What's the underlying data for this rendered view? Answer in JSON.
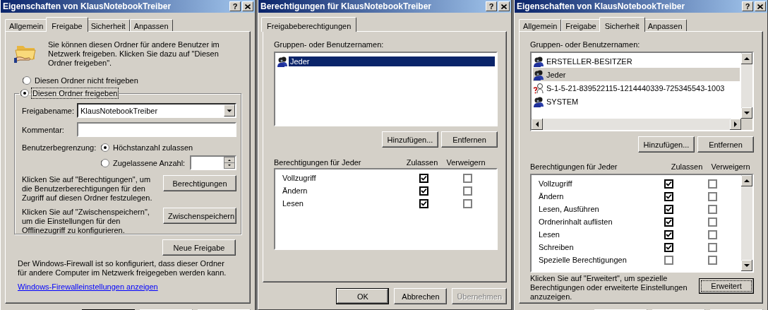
{
  "dialogs": [
    {
      "kind": "sharing",
      "title": "Eigenschaften von KlausNotebookTreiber",
      "help_button": "?",
      "tabs": [
        {
          "label": "Allgemein",
          "selected": false
        },
        {
          "label": "Freigabe",
          "selected": true
        },
        {
          "label": "Sicherheit",
          "selected": false
        },
        {
          "label": "Anpassen",
          "selected": false
        }
      ],
      "intro": "Sie können diesen Ordner für andere Benutzer im Netzwerk freigeben. Klicken Sie dazu auf \"Diesen Ordner freigeben\".",
      "share_options": [
        {
          "label": "Diesen Ordner nicht freigeben",
          "selected": false
        },
        {
          "label": "Diesen Ordner freigeben",
          "selected": true
        }
      ],
      "share_name": {
        "label": "Freigabename:",
        "value": "KlausNotebookTreiber"
      },
      "comment": {
        "label": "Kommentar:"
      },
      "user_limit": {
        "label": "Benutzerbegrenzung:",
        "options": [
          {
            "label": "Höchstanzahl zulassen",
            "selected": true
          },
          {
            "label": "Zugelassene Anzahl:",
            "selected": false
          }
        ]
      },
      "permissions_hint": "Klicken Sie auf \"Berechtigungen\", um die Benutzerberechtigungen für den Zugriff auf diesen Ordner festzulegen.",
      "permissions_button": "Berechtigungen",
      "caching_hint": "Klicken Sie auf \"Zwischenspeichern\", um die Einstellungen für den Offlinezugriff zu konfigurieren.",
      "caching_button": "Zwischenspeichern",
      "new_share_button": "Neue Freigabe",
      "firewall_note": "Der Windows-Firewall ist so konfiguriert, dass dieser Ordner für andere Computer im Netzwerk freigegeben werden kann.",
      "firewall_link": "Windows-Firewalleinstellungen anzeigen"
    },
    {
      "kind": "share_permissions",
      "title": "Berechtigungen für KlausNotebookTreiber",
      "help_button": "?",
      "tabs": [
        {
          "label": "Freigabeberechtigungen",
          "selected": true
        }
      ],
      "groups_label": "Gruppen- oder Benutzernamen:",
      "principals": [
        {
          "name": "Jeder",
          "kind": "group",
          "selected": true
        }
      ],
      "add_button": "Hinzufügen...",
      "remove_button": "Entfernen",
      "permissions_label": "Berechtigungen für Jeder",
      "columns": [
        "Zulassen",
        "Verweigern"
      ],
      "permissions": [
        {
          "name": "Vollzugriff",
          "allow": true,
          "deny": false
        },
        {
          "name": "Ändern",
          "allow": true,
          "deny": false
        },
        {
          "name": "Lesen",
          "allow": true,
          "deny": false
        }
      ],
      "footer_buttons": [
        {
          "label": "OK",
          "disabled": false
        },
        {
          "label": "Abbrechen",
          "disabled": false
        },
        {
          "label": "Übernehmen",
          "disabled": true
        }
      ]
    },
    {
      "kind": "security",
      "title": "Eigenschaften von KlausNotebookTreiber",
      "help_button": "?",
      "tabs": [
        {
          "label": "Allgemein",
          "selected": false
        },
        {
          "label": "Freigabe",
          "selected": false
        },
        {
          "label": "Sicherheit",
          "selected": true
        },
        {
          "label": "Anpassen",
          "selected": false
        }
      ],
      "groups_label": "Gruppen- oder Benutzernamen:",
      "principals": [
        {
          "name": "ERSTELLER-BESITZER",
          "kind": "group",
          "selected": false
        },
        {
          "name": "Jeder",
          "kind": "group",
          "selected": true
        },
        {
          "name": "S-1-5-21-839522115-1214440339-725345543-1003",
          "kind": "unknown",
          "selected": false
        },
        {
          "name": "SYSTEM",
          "kind": "group",
          "selected": false
        }
      ],
      "add_button": "Hinzufügen...",
      "remove_button": "Entfernen",
      "permissions_label": "Berechtigungen für Jeder",
      "columns": [
        "Zulassen",
        "Verweigern"
      ],
      "permissions": [
        {
          "name": "Vollzugriff",
          "allow": true,
          "deny": false
        },
        {
          "name": "Ändern",
          "allow": true,
          "deny": false
        },
        {
          "name": "Lesen, Ausführen",
          "allow": true,
          "deny": false
        },
        {
          "name": "Ordnerinhalt auflisten",
          "allow": true,
          "deny": false
        },
        {
          "name": "Lesen",
          "allow": true,
          "deny": false
        },
        {
          "name": "Schreiben",
          "allow": true,
          "deny": false
        },
        {
          "name": "Spezielle Berechtigungen",
          "allow": false,
          "deny": false
        }
      ],
      "advanced_hint": "Klicken Sie auf \"Erweitert\", um spezielle Berechtigungen oder erweiterte Einstellungen anzuzeigen.",
      "advanced_button": "Erweitert"
    }
  ]
}
